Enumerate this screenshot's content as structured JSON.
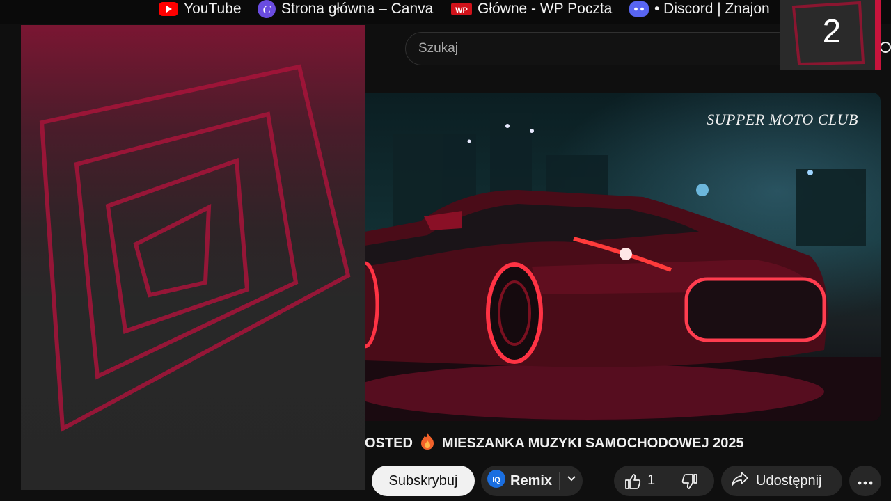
{
  "bookmarks": [
    {
      "label": "YouTube",
      "icon": "youtube-icon"
    },
    {
      "label": "Strona główna – Canva",
      "icon": "canva-icon"
    },
    {
      "label": "Główne - WP Poczta",
      "icon": "wp-icon"
    },
    {
      "label": "• Discord | Znajon",
      "icon": "discord-icon"
    }
  ],
  "search": {
    "placeholder": "Szukaj"
  },
  "badge": {
    "number": "2"
  },
  "thumbnail": {
    "brand_text": "SUPPER MOTO CLUB"
  },
  "video": {
    "title_prefix": "OSTED",
    "title_main": "MIESZANKA MUZYKI SAMOCHODOWEJ 2025"
  },
  "actions": {
    "subscribe_label": "Subskrybuj",
    "remix_label": "Remix",
    "like_count": "1",
    "share_label": "Udostępnij"
  },
  "colors": {
    "accent": "#c8143c",
    "surface": "#272727",
    "background": "#0f0f0f"
  }
}
